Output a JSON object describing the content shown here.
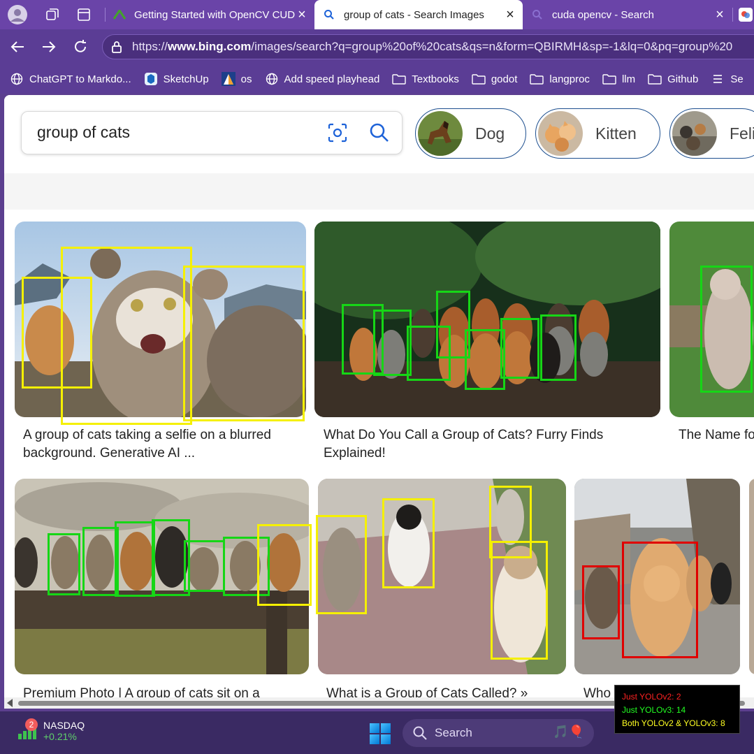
{
  "tabs": [
    {
      "title": "Getting Started with OpenCV CUD",
      "active": false
    },
    {
      "title": "group of cats - Search Images",
      "active": true
    },
    {
      "title": "cuda opencv - Search",
      "active": false
    }
  ],
  "address": {
    "prefix": "https://",
    "domain": "www.bing.com",
    "path": "/images/search?q=group%20of%20cats&qs=n&form=QBIRMH&sp=-1&lq=0&pq=group%20"
  },
  "bookmarks": [
    {
      "label": "ChatGPT to Markdo...",
      "icon": "globe-icon"
    },
    {
      "label": "SketchUp",
      "icon": "sketchup-icon"
    },
    {
      "label": "os",
      "icon": "os-icon"
    },
    {
      "label": "Add speed playhead",
      "icon": "globe-icon"
    },
    {
      "label": "Textbooks",
      "icon": "folder-icon"
    },
    {
      "label": "godot",
      "icon": "folder-icon"
    },
    {
      "label": "langproc",
      "icon": "folder-icon"
    },
    {
      "label": "llm",
      "icon": "folder-icon"
    },
    {
      "label": "Github",
      "icon": "folder-icon"
    },
    {
      "label": "Se",
      "icon": "list-icon"
    }
  ],
  "search": {
    "query": "group of cats",
    "chips": [
      "Dog",
      "Kitten",
      "Feli"
    ]
  },
  "results": [
    {
      "caption": "A group of cats taking a selfie on a blurred background. Generative AI ..."
    },
    {
      "caption": "What Do You Call a Group of Cats? Furry Finds Explained!"
    },
    {
      "caption": "The Name fo"
    },
    {
      "caption": "Premium Photo | A group of cats sit on a"
    },
    {
      "caption": "What is a Group of Cats Called? »"
    },
    {
      "caption": "Who"
    }
  ],
  "stats": {
    "just_yolov2": "Just YOLOv2: 2",
    "just_yolov3": "Just YOLOv3: 14",
    "both": "Both YOLOv2 & YOLOv3: 8"
  },
  "taskbar": {
    "stock_badge": "2",
    "stock_name": "NASDAQ",
    "stock_change": "+0.21%",
    "search_placeholder": "Search"
  },
  "colors": {
    "tab_bar": "#6a44a8",
    "accent_blue": "#1d62d8",
    "detect_both": "#f5f000",
    "detect_v3": "#16d616",
    "detect_v2": "#e00000"
  }
}
